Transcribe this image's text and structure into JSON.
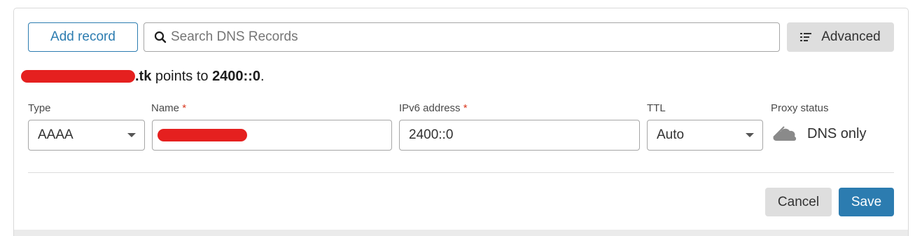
{
  "toolbar": {
    "add_record_label": "Add record",
    "search_placeholder": "Search DNS Records",
    "advanced_label": "Advanced"
  },
  "summary": {
    "domain_suffix": ".tk",
    "points_text": " points to ",
    "target": "2400::0",
    "period": "."
  },
  "form": {
    "type_label": "Type",
    "type_value": "AAAA",
    "name_label": "Name",
    "required_mark": "*",
    "ipv6_label": "IPv6 address",
    "ipv6_value": "2400::0",
    "ttl_label": "TTL",
    "ttl_value": "Auto",
    "proxy_label": "Proxy status",
    "proxy_value": "DNS only",
    "proxy_icon": "cloud-dns-only-icon"
  },
  "actions": {
    "cancel_label": "Cancel",
    "save_label": "Save"
  },
  "colors": {
    "accent": "#2c7cb0",
    "redaction": "#e5201f",
    "button_grey": "#dedede",
    "required": "#d9381e"
  }
}
